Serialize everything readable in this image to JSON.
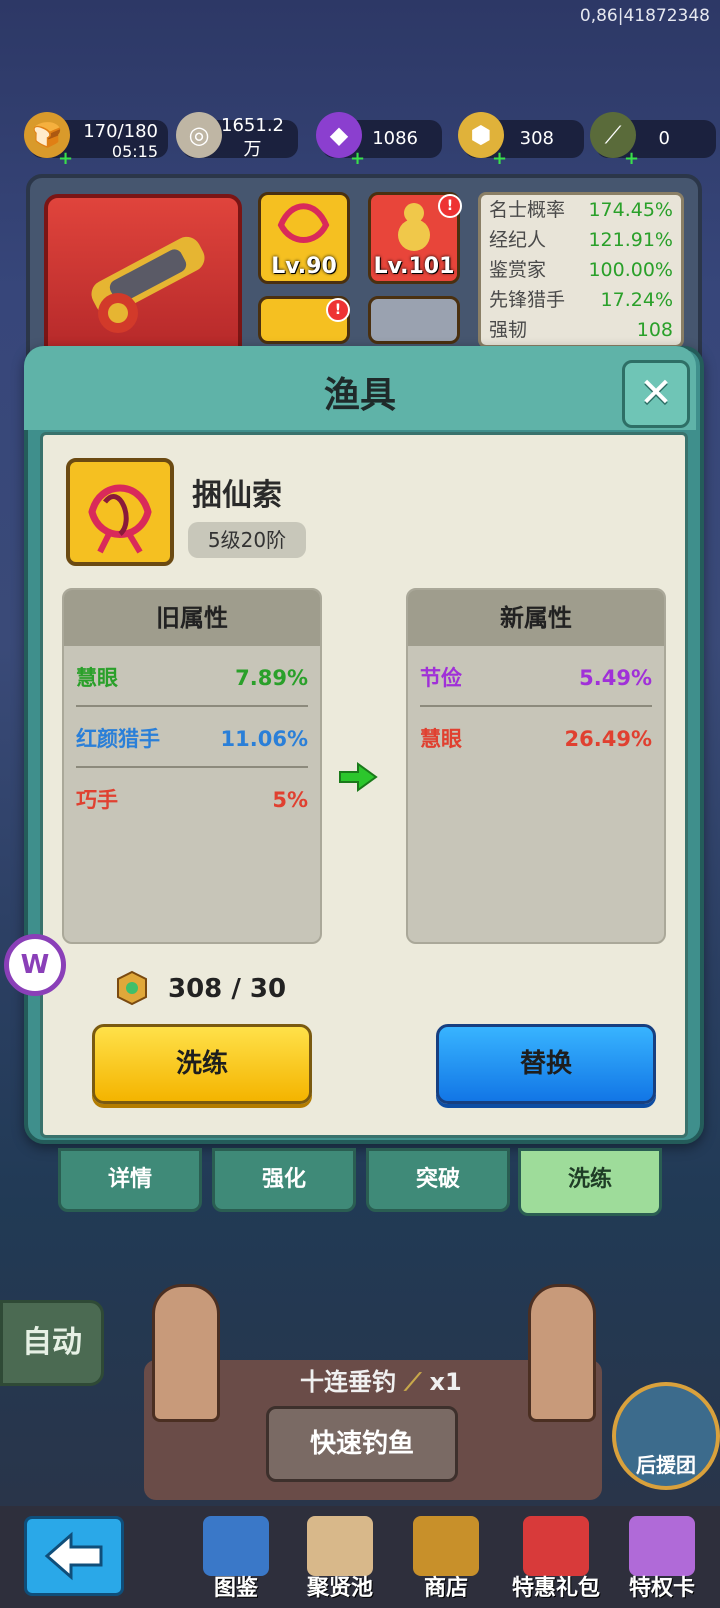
{
  "top_info": "0,86|41872348",
  "resources": [
    {
      "name": "stamina",
      "value": "170/180",
      "sub": "05:15",
      "icon": "bread-icon",
      "color": "#d99a2b"
    },
    {
      "name": "coins",
      "value": "1651.2",
      "sub": "万",
      "icon": "coin-icon",
      "color": "#bfb6a4"
    },
    {
      "name": "gems",
      "value": "1086",
      "icon": "purple-gem-icon",
      "color": "#8b3fcf"
    },
    {
      "name": "stones",
      "value": "308",
      "icon": "refine-stone-icon",
      "color": "#e0b23a"
    },
    {
      "name": "rods",
      "value": "0",
      "icon": "fishing-rod-icon",
      "color": "#c8a84a"
    }
  ],
  "background_items": {
    "levels": [
      "Lv.90",
      "Lv.101"
    ],
    "stats": [
      {
        "label": "名士概率",
        "value": "174.45%"
      },
      {
        "label": "经纪人",
        "value": "121.91%"
      },
      {
        "label": "鉴赏家",
        "value": "100.00%"
      },
      {
        "label": "先锋猎手",
        "value": "17.24%"
      },
      {
        "label": "强韧",
        "value": "108"
      }
    ]
  },
  "modal": {
    "title": "渔具",
    "item_name": "捆仙索",
    "item_grade": "5级20阶",
    "old_header": "旧属性",
    "new_header": "新属性",
    "old_attrs": [
      {
        "name": "慧眼",
        "value": "7.89%",
        "color": "#2aa02a"
      },
      {
        "name": "红颜猎手",
        "value": "11.06%",
        "color": "#2a7fd8"
      },
      {
        "name": "巧手",
        "value": "5%",
        "color": "#e04030"
      }
    ],
    "new_attrs": [
      {
        "name": "节俭",
        "value": "5.49%",
        "color": "#a030d8"
      },
      {
        "name": "慧眼",
        "value": "26.49%",
        "color": "#e04030"
      }
    ],
    "cost": "308 / 30",
    "refine_button": "洗练",
    "replace_button": "替换"
  },
  "tabs": [
    "详情",
    "强化",
    "突破",
    "洗练"
  ],
  "active_tab": 3,
  "scene": {
    "auto_button": "自动",
    "ten_pull": "十连垂钓",
    "ten_pull_count": "x1",
    "fast_fish": "快速钓鱼",
    "support_team": "后援团"
  },
  "bottom_nav": [
    {
      "label": "图鉴",
      "icon": "catalog-icon"
    },
    {
      "label": "聚贤池",
      "icon": "map-scroll-icon"
    },
    {
      "label": "商店",
      "icon": "shop-icon"
    },
    {
      "label": "特惠礼包",
      "icon": "gift-pack-icon"
    },
    {
      "label": "特权卡",
      "icon": "privilege-card-icon"
    }
  ]
}
